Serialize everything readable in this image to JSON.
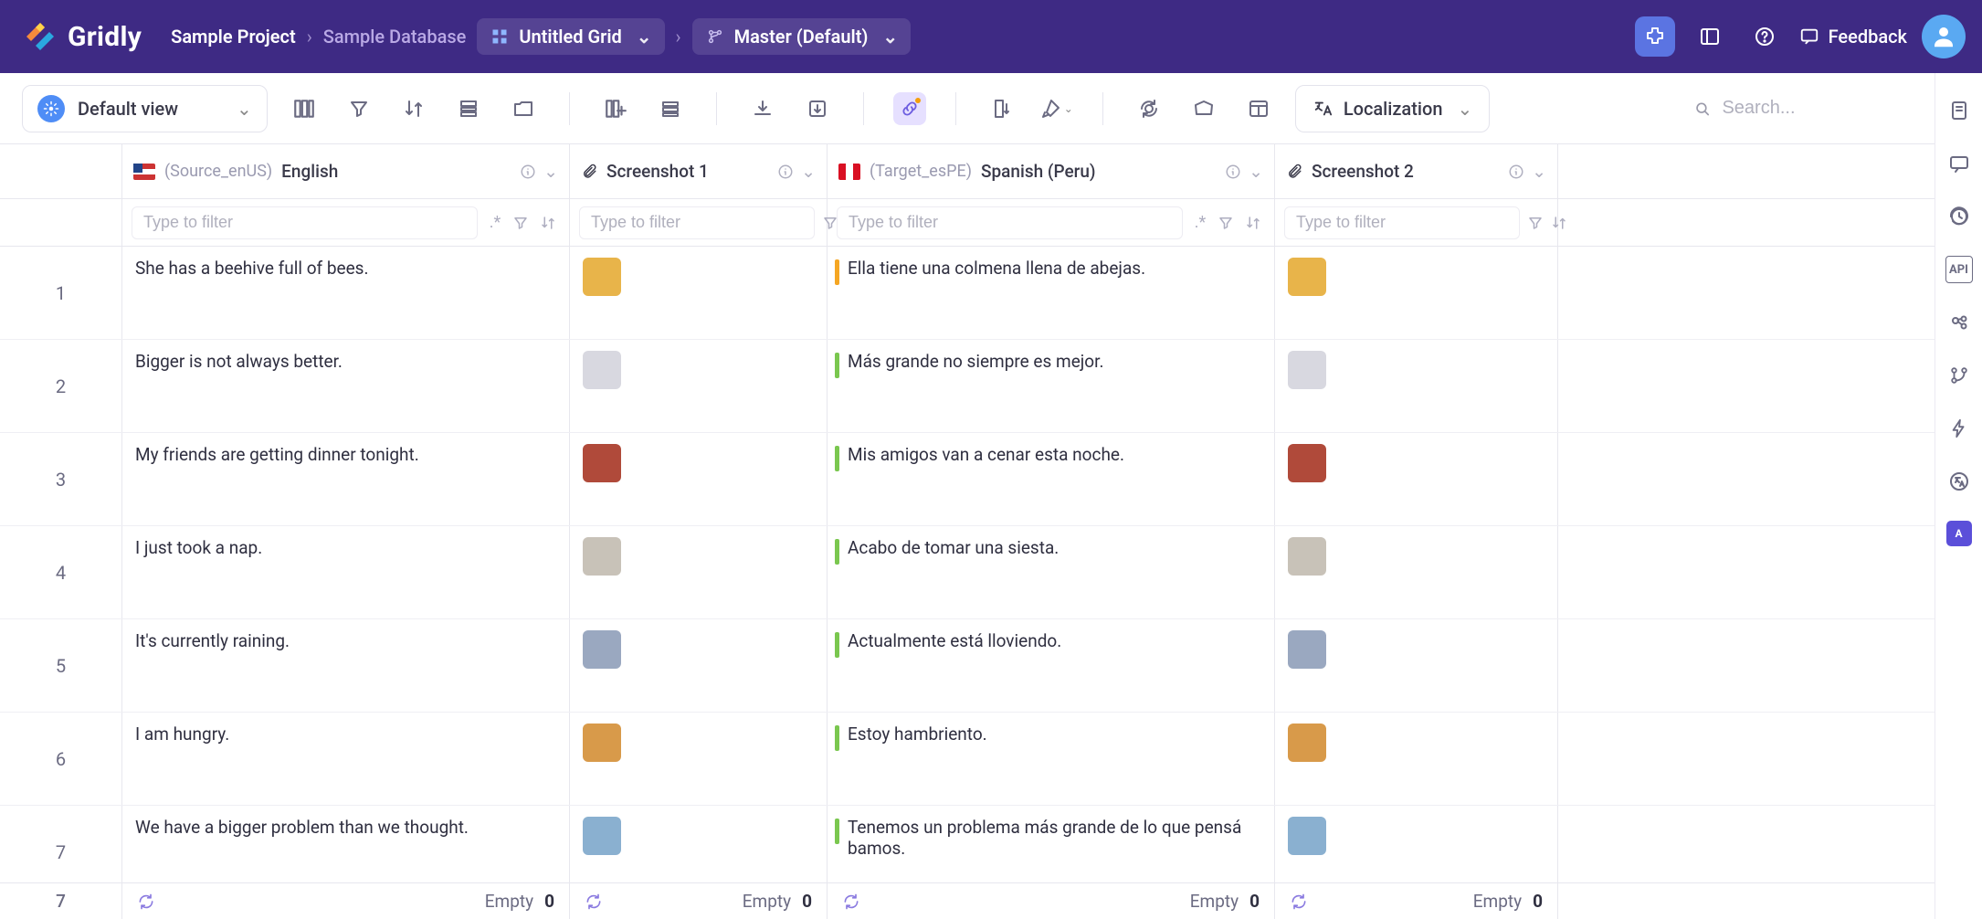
{
  "app": {
    "name": "Gridly"
  },
  "breadcrumbs": {
    "project": "Sample Project",
    "database": "Sample Database",
    "grid": "Untitled Grid",
    "branch": "Master (Default)"
  },
  "header_actions": {
    "feedback_label": "Feedback"
  },
  "toolbar": {
    "view_label": "Default view",
    "localization_label": "Localization",
    "search_placeholder": "Search..."
  },
  "columns": {
    "english": {
      "id": "(Source_enUS)",
      "name": "English",
      "filter_placeholder": "Type to filter"
    },
    "screenshot1": {
      "name": "Screenshot 1",
      "filter_placeholder": "Type to filter"
    },
    "spanish": {
      "id": "(Target_esPE)",
      "name": "Spanish (Peru)",
      "filter_placeholder": "Type to filter"
    },
    "screenshot2": {
      "name": "Screenshot 2",
      "filter_placeholder": "Type to filter"
    }
  },
  "rows": [
    {
      "n": "1",
      "en": "She has a beehive full of bees.",
      "es": "Ella tiene una colmena llena de abejas.",
      "status": "orange",
      "thumb1": "#e8b44a",
      "thumb2": "#e8b44a"
    },
    {
      "n": "2",
      "en": "Bigger is not always better.",
      "es": "Más grande no siempre es mejor.",
      "status": "green",
      "thumb1": "#d8d8e0",
      "thumb2": "#d8d8e0"
    },
    {
      "n": "3",
      "en": "My friends are getting dinner tonight.",
      "es": "Mis amigos van a cenar esta noche.",
      "status": "green",
      "thumb1": "#b04a3a",
      "thumb2": "#b04a3a"
    },
    {
      "n": "4",
      "en": "I just took a nap.",
      "es": "Acabo de tomar una siesta.",
      "status": "green",
      "thumb1": "#c8c2b8",
      "thumb2": "#c8c2b8"
    },
    {
      "n": "5",
      "en": "It's currently raining.",
      "es": "Actualmente está lloviendo.",
      "status": "green",
      "thumb1": "#9aa8c0",
      "thumb2": "#9aa8c0"
    },
    {
      "n": "6",
      "en": "I am hungry.",
      "es": "Estoy hambriento.",
      "status": "green",
      "thumb1": "#d89a4a",
      "thumb2": "#d89a4a"
    },
    {
      "n": "7",
      "en": "We have a bigger problem than we thought.",
      "es": "Tenemos un problema más grande de lo que pensá bamos.",
      "status": "green",
      "thumb1": "#8ab0d0",
      "thumb2": "#8ab0d0"
    }
  ],
  "footer": {
    "total_rows": "7",
    "empty_label": "Empty",
    "empty_count": "0"
  }
}
